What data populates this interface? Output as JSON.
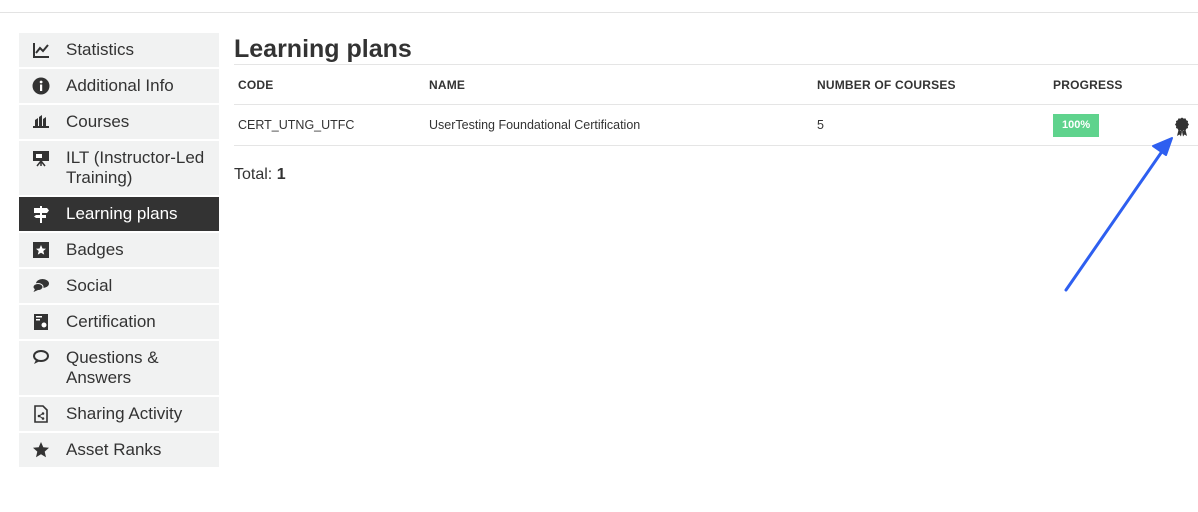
{
  "sidebar": {
    "items": [
      {
        "label": "Statistics",
        "icon": "chart-line-icon"
      },
      {
        "label": "Additional Info",
        "icon": "info-circle-icon"
      },
      {
        "label": "Courses",
        "icon": "courses-icon"
      },
      {
        "label": "ILT (Instructor-Led Training)",
        "icon": "presentation-icon"
      },
      {
        "label": "Learning plans",
        "icon": "signpost-icon",
        "active": true
      },
      {
        "label": "Badges",
        "icon": "star-square-icon"
      },
      {
        "label": "Social",
        "icon": "chat-bubbles-icon"
      },
      {
        "label": "Certification",
        "icon": "certificate-icon"
      },
      {
        "label": "Questions & Answers",
        "icon": "question-bubbles-icon"
      },
      {
        "label": "Sharing Activity",
        "icon": "share-document-icon"
      },
      {
        "label": "Asset Ranks",
        "icon": "star-icon"
      }
    ]
  },
  "main": {
    "title": "Learning plans",
    "table": {
      "headers": {
        "code": "CODE",
        "name": "NAME",
        "number_of_courses": "NUMBER OF COURSES",
        "progress": "PROGRESS"
      },
      "rows": [
        {
          "code": "CERT_UTNG_UTFC",
          "name": "UserTesting Foundational Certification",
          "number_of_courses": "5",
          "progress": "100%",
          "progress_value": 1.0,
          "action_icon": "certificate-award-icon"
        }
      ]
    },
    "total_label": "Total:",
    "total_value": "1"
  },
  "colors": {
    "active_bg": "#333333",
    "sidebar_bg": "#f1f2f2",
    "progress_green": "#5fd38d",
    "annotation_arrow": "#2e5ff0"
  }
}
